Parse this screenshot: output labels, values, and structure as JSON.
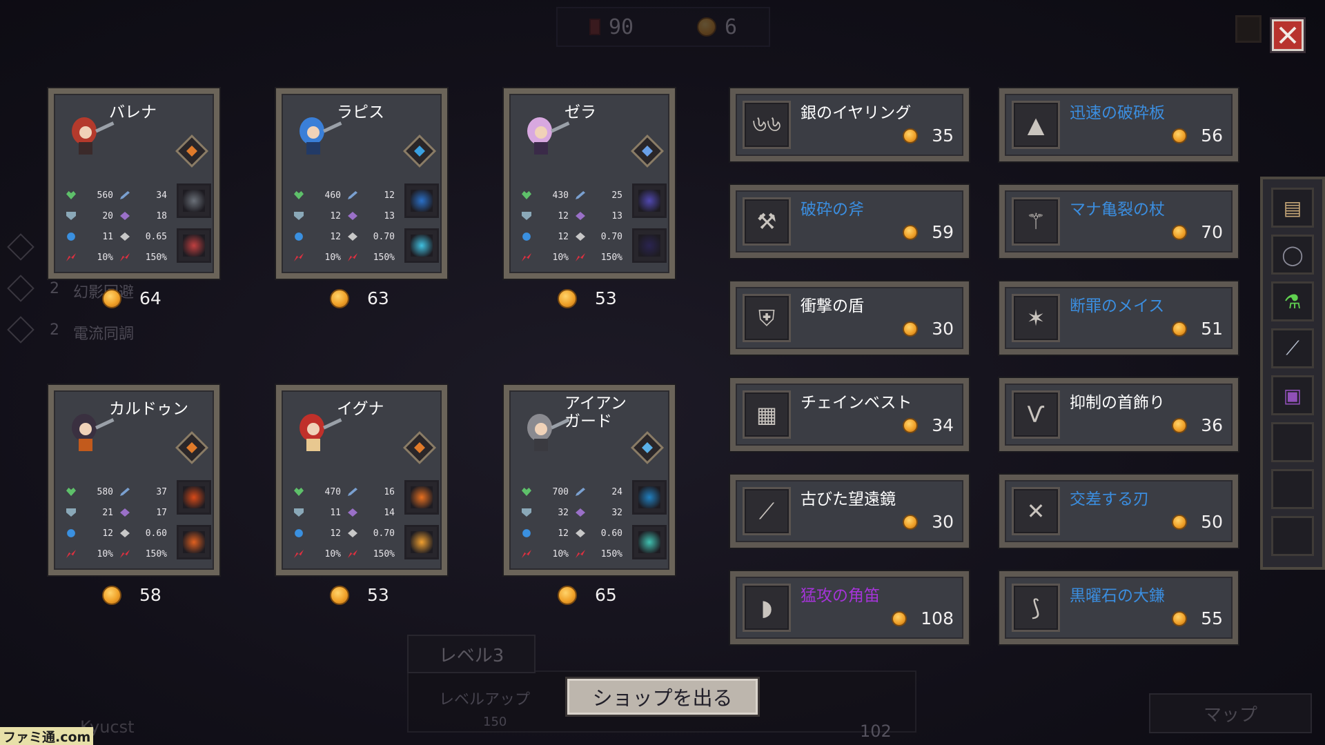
{
  "topbar": {
    "currency1_icon": "card-icon",
    "currency1": "90",
    "currency2_icon": "coin-icon",
    "currency2": "6"
  },
  "close_icon": "close-icon",
  "background": {
    "synergies": [
      {
        "count": "2",
        "label": "幻影回避"
      },
      {
        "count": "2",
        "label": "電流同調"
      }
    ],
    "level_label": "レベル3",
    "levelup_label": "レベルアップ",
    "levelup_cost": "150",
    "soul_count": "102",
    "map_label": "マップ",
    "username": "Kyucst"
  },
  "heroes": [
    {
      "name": "バレナ",
      "class_icon": "fire-crest-icon",
      "hp": "560",
      "atk": "34",
      "def": "20",
      "mag": "18",
      "mana": "11",
      "spd": "0.65",
      "crit": "10%",
      "critdmg": "150%",
      "skill1": "shield-skill-icon",
      "skill2": "cross-slash-skill-icon",
      "price": "64"
    },
    {
      "name": "ラピス",
      "class_icon": "water-crest-icon",
      "hp": "460",
      "atk": "12",
      "def": "12",
      "mag": "13",
      "mana": "12",
      "spd": "0.70",
      "crit": "10%",
      "critdmg": "150%",
      "skill1": "whirlpool-skill-icon",
      "skill2": "ice-crystal-skill-icon",
      "price": "63"
    },
    {
      "name": "ゼラ",
      "class_icon": "void-crest-icon",
      "hp": "430",
      "atk": "25",
      "def": "12",
      "mag": "13",
      "mana": "12",
      "spd": "0.70",
      "crit": "10%",
      "critdmg": "150%",
      "skill1": "shadow-claw-skill-icon",
      "skill2": "vortex-skill-icon",
      "price": "53"
    },
    {
      "name": "カルドゥン",
      "class_icon": "fire-crest-icon",
      "hp": "580",
      "atk": "37",
      "def": "21",
      "mag": "17",
      "mana": "12",
      "spd": "0.60",
      "crit": "10%",
      "critdmg": "150%",
      "skill1": "lava-burst-skill-icon",
      "skill2": "fire-ring-skill-icon",
      "price": "58"
    },
    {
      "name": "イグナ",
      "class_icon": "fire-crest-icon",
      "hp": "470",
      "atk": "16",
      "def": "11",
      "mag": "14",
      "mana": "12",
      "spd": "0.70",
      "crit": "10%",
      "critdmg": "150%",
      "skill1": "fire-pillar-skill-icon",
      "skill2": "explosion-skill-icon",
      "price": "53"
    },
    {
      "name": "アイアン\nガード",
      "class_icon": "ice-crest-icon",
      "hp": "700",
      "atk": "24",
      "def": "32",
      "mag": "32",
      "mana": "12",
      "spd": "0.60",
      "crit": "10%",
      "critdmg": "150%",
      "skill1": "ice-armor-skill-icon",
      "skill2": "ice-dome-skill-icon",
      "price": "65"
    }
  ],
  "items": [
    {
      "name": "銀のイヤリング",
      "rarity": "common",
      "icon": "earring-icon",
      "price": "35"
    },
    {
      "name": "迅速の破砕板",
      "rarity": "rare",
      "icon": "rune-stone-icon",
      "price": "56"
    },
    {
      "name": "破砕の斧",
      "rarity": "rare",
      "icon": "axe-icon",
      "price": "59"
    },
    {
      "name": "マナ亀裂の杖",
      "rarity": "rare",
      "icon": "staff-icon",
      "price": "70"
    },
    {
      "name": "衝撃の盾",
      "rarity": "common",
      "icon": "shield-icon",
      "price": "30"
    },
    {
      "name": "断罪のメイス",
      "rarity": "rare",
      "icon": "mace-icon",
      "price": "51"
    },
    {
      "name": "チェインベスト",
      "rarity": "common",
      "icon": "chainmail-icon",
      "price": "34"
    },
    {
      "name": "抑制の首飾り",
      "rarity": "common",
      "icon": "necklace-icon",
      "price": "36"
    },
    {
      "name": "古びた望遠鏡",
      "rarity": "common",
      "icon": "telescope-icon",
      "price": "30"
    },
    {
      "name": "交差する刃",
      "rarity": "rare",
      "icon": "crossed-blades-icon",
      "price": "50"
    },
    {
      "name": "猛攻の角笛",
      "rarity": "epic",
      "icon": "horn-icon",
      "price": "108"
    },
    {
      "name": "黒曜石の大鎌",
      "rarity": "rare",
      "icon": "scythe-icon",
      "price": "55"
    }
  ],
  "inventory": [
    "scroll-icon",
    "collar-icon",
    "potion-icon",
    "sword-icon",
    "tome-icon",
    "empty",
    "empty",
    "empty"
  ],
  "exit_label": "ショップを出る",
  "watermark": "ファミ通.com",
  "colors": {
    "common": "#ffffff",
    "rare": "#3b8ee0",
    "epic": "#a534d8",
    "close": "#b8342e",
    "frame": "#6b6459"
  }
}
